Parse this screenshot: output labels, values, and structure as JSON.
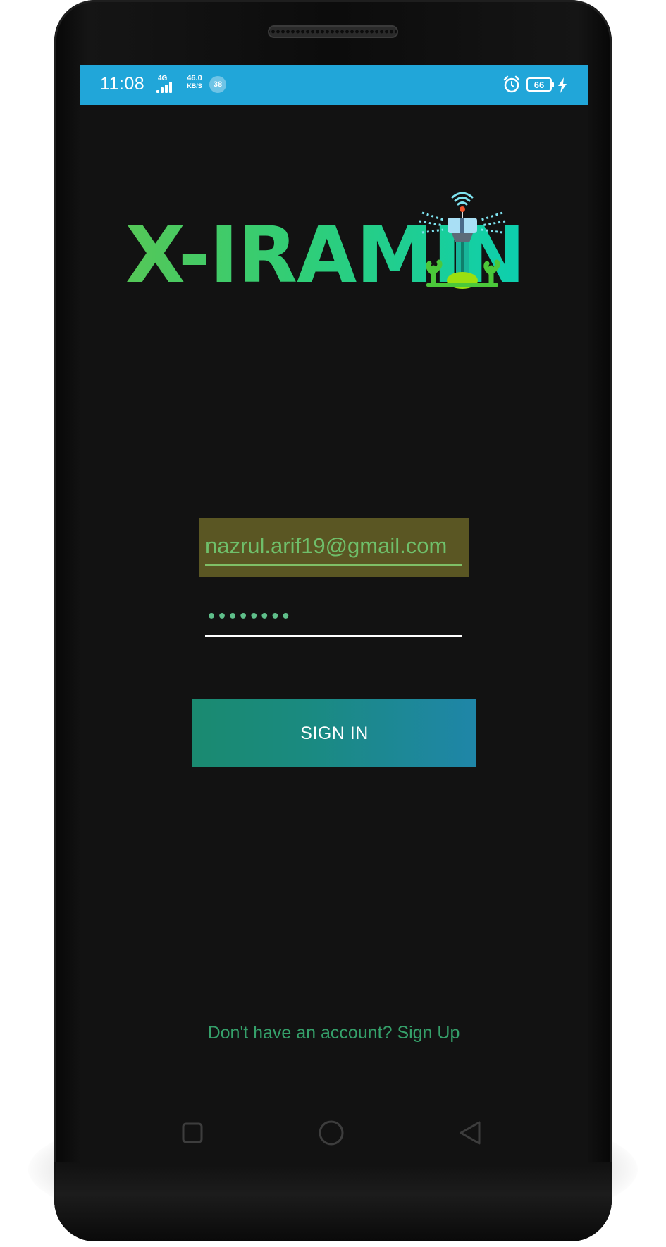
{
  "status_bar": {
    "time": "11:08",
    "network_type": "4G",
    "speed_value": "46.0",
    "speed_unit": "KB/S",
    "notification_count": "38",
    "battery_level": "66",
    "icons": [
      "signal-icon",
      "alarm-icon",
      "battery-icon",
      "charging-icon"
    ],
    "background_color": "#21a6d9"
  },
  "logo": {
    "text": "X-IRAMIN",
    "icon": "sprinkler-tower-icon"
  },
  "form": {
    "email_value": "nazrul.arif19@gmail.com",
    "password_value": "••••••••",
    "signin_label": "SIGN IN",
    "signup_text": "Don't have an account? Sign Up"
  },
  "nav_bar": {
    "icons": [
      "recents-icon",
      "home-icon",
      "back-icon"
    ]
  },
  "colors": {
    "screen_background": "#121212",
    "email_highlight": "#5a5623",
    "accent_green": "#35a06a",
    "button_gradient_start": "#1a8a70",
    "button_gradient_end": "#1f86a8"
  }
}
